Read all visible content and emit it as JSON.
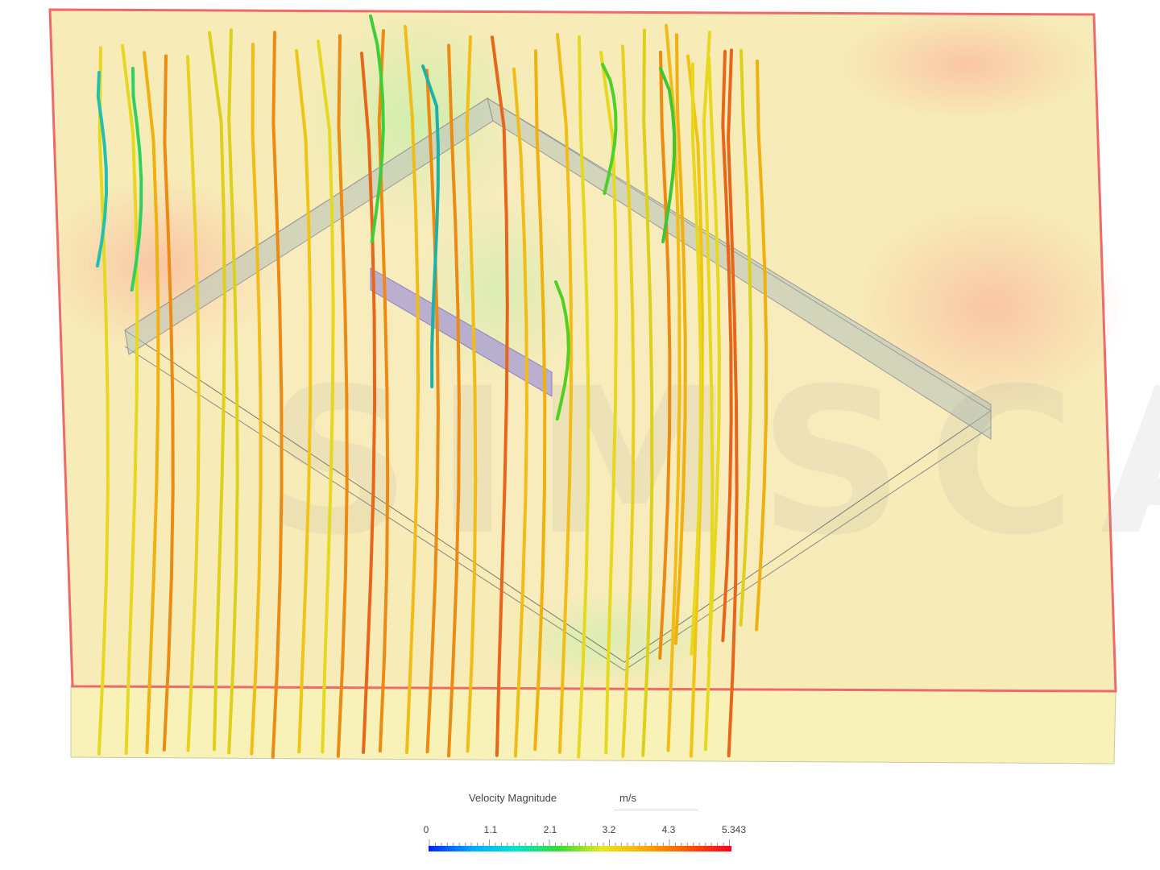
{
  "legend": {
    "title": "Velocity Magnitude",
    "unit": "m/s",
    "ticks": [
      "0",
      "1.1",
      "2.1",
      "3.2",
      "4.3",
      "5.343"
    ],
    "range": [
      0,
      5.343
    ],
    "colormap": [
      "#0022ff",
      "#00aaff",
      "#00e5d0",
      "#33dd33",
      "#e8e820",
      "#ffaa00",
      "#ff5500",
      "#ff0022"
    ]
  },
  "watermark": "SIMSCALE",
  "colors": {
    "domain_fill": "#f7f0b8",
    "domain_border": "#f07070",
    "obstacle_fill": "#c8d0c8",
    "baffle_fill": "#b0a8d8"
  }
}
